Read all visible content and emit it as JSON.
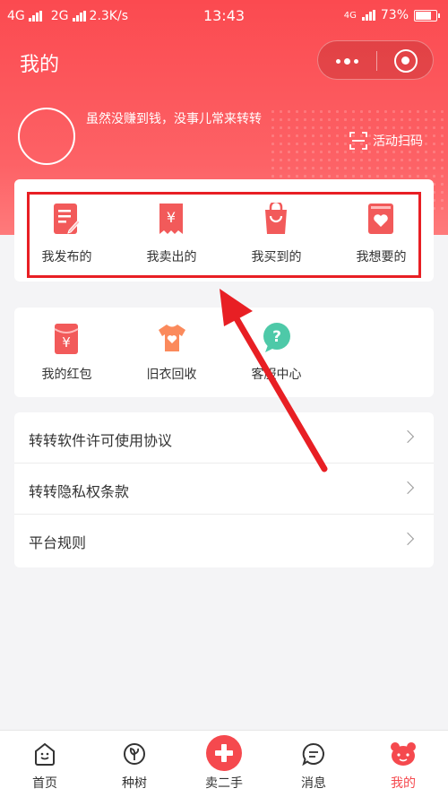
{
  "status_bar": {
    "network1": "4G",
    "network2": "2G",
    "speed": "2.3K/s",
    "time": "13:43",
    "network3": "4G",
    "battery": "73%"
  },
  "header": {
    "title": "我的",
    "slogan": "虽然没赚到钱，没事儿常来转转",
    "scan_label": "活动扫码"
  },
  "orders": {
    "items": [
      {
        "label": "我发布的",
        "icon": "publish-icon"
      },
      {
        "label": "我卖出的",
        "icon": "sold-icon"
      },
      {
        "label": "我买到的",
        "icon": "bought-icon"
      },
      {
        "label": "我想要的",
        "icon": "wishlist-icon"
      }
    ]
  },
  "services": {
    "items": [
      {
        "label": "我的红包",
        "icon": "red-envelope-icon"
      },
      {
        "label": "旧衣回收",
        "icon": "clothes-recycle-icon"
      },
      {
        "label": "客服中心",
        "icon": "customer-service-icon"
      }
    ]
  },
  "links": {
    "items": [
      {
        "label": "转转软件许可使用协议"
      },
      {
        "label": "转转隐私权条款"
      },
      {
        "label": "平台规则"
      }
    ]
  },
  "tabbar": {
    "items": [
      {
        "label": "首页",
        "icon": "home-icon"
      },
      {
        "label": "种树",
        "icon": "tree-icon"
      },
      {
        "label": "卖二手",
        "icon": "plus-icon"
      },
      {
        "label": "消息",
        "icon": "message-icon"
      },
      {
        "label": "我的",
        "icon": "profile-icon",
        "active": true
      }
    ]
  },
  "colors": {
    "brand": "#fb4a50",
    "annotation": "#e81f24"
  }
}
